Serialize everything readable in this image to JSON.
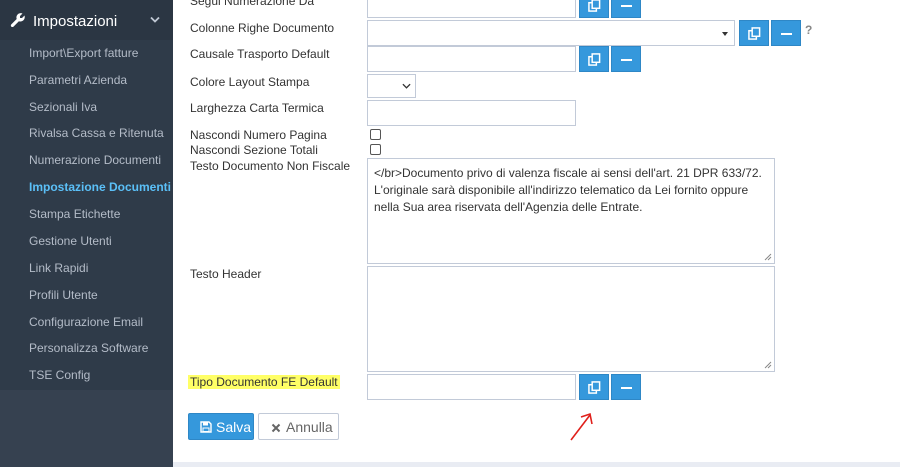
{
  "sidebar": {
    "section_title": "Impostazioni",
    "items": [
      {
        "label": "Import\\Export fatture"
      },
      {
        "label": "Parametri Azienda"
      },
      {
        "label": "Sezionali Iva"
      },
      {
        "label": "Rivalsa Cassa e Ritenuta"
      },
      {
        "label": "Numerazione Documenti"
      },
      {
        "label": "Impostazione Documenti"
      },
      {
        "label": "Stampa Etichette"
      },
      {
        "label": "Gestione Utenti"
      },
      {
        "label": "Link Rapidi"
      },
      {
        "label": "Profili Utente"
      },
      {
        "label": "Configurazione Email"
      },
      {
        "label": "Personalizza Software"
      },
      {
        "label": "TSE Config"
      }
    ],
    "active_item": "Impostazione Documenti"
  },
  "form": {
    "segui_numerazione_label": "Segui Numerazione Da",
    "colonne_righe_label": "Colonne Righe Documento",
    "causale_trasporto_label": "Causale Trasporto Default",
    "colore_layout_label": "Colore Layout Stampa",
    "larghezza_carta_label": "Larghezza Carta Termica",
    "nascondi_numero_label": "Nascondi Numero Pagina",
    "nascondi_sezione_label": "Nascondi Sezione Totali",
    "testo_non_fiscale_label": "Testo Documento Non Fiscale",
    "testo_non_fiscale_value": "</br>Documento privo di valenza fiscale ai sensi dell'art. 21 DPR 633/72. L'originale sarà disponibile all'indirizzo telematico da Lei fornito oppure nella Sua area riservata dell'Agenzia delle Entrate.",
    "testo_header_label": "Testo Header",
    "tipo_documento_label": "Tipo Documento FE Default",
    "help_mark": "?"
  },
  "actions": {
    "save_label": "Salva",
    "cancel_label": "Annulla"
  },
  "colors": {
    "accent": "#3598dc",
    "sidebar_bg": "#364150",
    "active_item": "#5bc0f8",
    "highlight": "#ffff66",
    "annotation_arrow": "#e0201b"
  }
}
